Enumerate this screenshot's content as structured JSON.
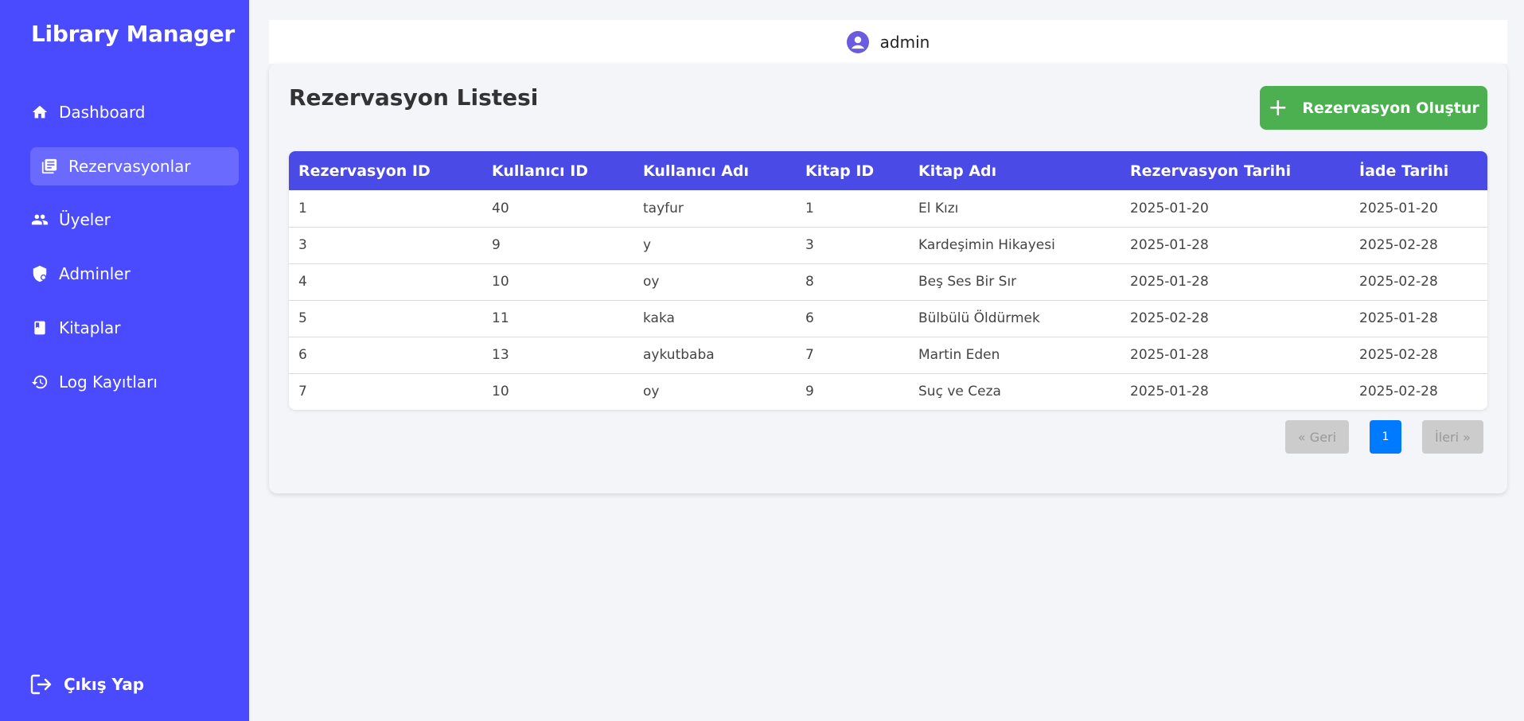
{
  "app": {
    "title": "Library Manager"
  },
  "sidebar": {
    "items": [
      {
        "label": "Dashboard",
        "icon": "home-icon"
      },
      {
        "label": "Rezervasyonlar",
        "icon": "list-icon",
        "active": true
      },
      {
        "label": "Üyeler",
        "icon": "users-icon"
      },
      {
        "label": "Adminler",
        "icon": "shield-icon"
      },
      {
        "label": "Kitaplar",
        "icon": "book-icon"
      },
      {
        "label": "Log Kayıtları",
        "icon": "history-icon"
      }
    ],
    "logout_label": "Çıkış Yap"
  },
  "header": {
    "username": "admin"
  },
  "main": {
    "title": "Rezervasyon Listesi",
    "create_label": "Rezervasyon Oluştur",
    "columns": [
      "Rezervasyon ID",
      "Kullanıcı ID",
      "Kullanıcı Adı",
      "Kitap ID",
      "Kitap Adı",
      "Rezervasyon Tarihi",
      "İade Tarihi"
    ],
    "rows": [
      [
        "1",
        "40",
        "tayfur",
        "1",
        "El Kızı",
        "2025-01-20",
        "2025-01-20"
      ],
      [
        "3",
        "9",
        "y",
        "3",
        "Kardeşimin Hikayesi",
        "2025-01-28",
        "2025-02-28"
      ],
      [
        "4",
        "10",
        "oy",
        "8",
        "Beş Ses Bir Sır",
        "2025-01-28",
        "2025-02-28"
      ],
      [
        "5",
        "11",
        "kaka",
        "6",
        "Bülbülü Öldürmek",
        "2025-02-28",
        "2025-01-28"
      ],
      [
        "6",
        "13",
        "aykutbaba",
        "7",
        "Martin Eden",
        "2025-01-28",
        "2025-02-28"
      ],
      [
        "7",
        "10",
        "oy",
        "9",
        "Suç ve Ceza",
        "2025-01-28",
        "2025-02-28"
      ]
    ],
    "pagination": {
      "prev": "« Geri",
      "current": "1",
      "next": "İleri »"
    }
  },
  "colors": {
    "sidebar": "#4a4aff",
    "accent": "#4a4ae6",
    "create": "#4caf50",
    "page_active": "#007bff"
  }
}
